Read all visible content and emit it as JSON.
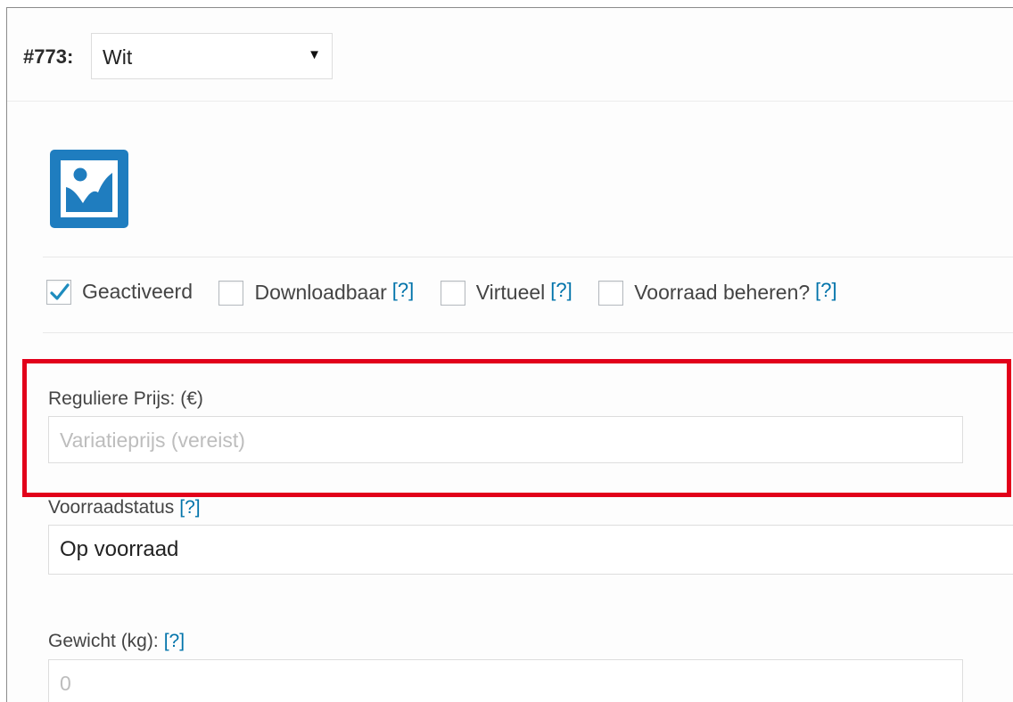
{
  "variation": {
    "id_label": "#773:",
    "selected_value": "Wit",
    "arrow_glyph": "▼"
  },
  "image_button": {
    "icon": "image-placeholder-icon",
    "color": "#1f7dbf"
  },
  "options": [
    {
      "label": "Geactiveerd",
      "checked": true,
      "help": ""
    },
    {
      "label": "Downloadbaar",
      "checked": false,
      "help": "[?]"
    },
    {
      "label": "Virtueel",
      "checked": false,
      "help": "[?]"
    },
    {
      "label": "Voorraad beheren?",
      "checked": false,
      "help": "[?]"
    }
  ],
  "regular_price": {
    "label": "Reguliere Prijs: (€)",
    "placeholder": "Variatieprijs (vereist)"
  },
  "stock_status": {
    "label": "Voorraadstatus",
    "help": "[?]",
    "value": "Op voorraad"
  },
  "weight": {
    "label": "Gewicht (kg):",
    "help": "[?]",
    "placeholder": "0"
  },
  "colors": {
    "link": "#0073aa",
    "highlight": "#e2001a",
    "check": "#1e8cbe"
  }
}
